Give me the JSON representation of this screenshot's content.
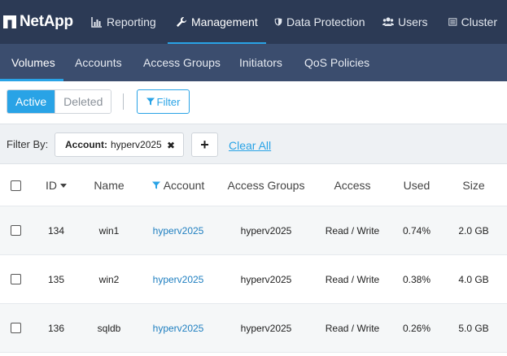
{
  "brand": {
    "name": "NetApp"
  },
  "topnav": {
    "items": [
      {
        "label": "Reporting",
        "icon": "bar-chart-icon"
      },
      {
        "label": "Management",
        "icon": "wrench-icon",
        "active": true
      },
      {
        "label": "Data Protection",
        "icon": "shield-icon"
      },
      {
        "label": "Users",
        "icon": "users-icon"
      },
      {
        "label": "Cluster",
        "icon": "list-icon"
      }
    ]
  },
  "subnav": {
    "items": [
      {
        "label": "Volumes",
        "active": true
      },
      {
        "label": "Accounts"
      },
      {
        "label": "Access Groups"
      },
      {
        "label": "Initiators"
      },
      {
        "label": "QoS Policies"
      }
    ]
  },
  "toolbar": {
    "active_label": "Active",
    "deleted_label": "Deleted",
    "filter_label": "Filter"
  },
  "filterbar": {
    "label": "Filter By:",
    "chip_key": "Account:",
    "chip_value": "hyperv2025",
    "add_label": "+",
    "clear_label": "Clear All"
  },
  "table": {
    "headers": {
      "id": "ID",
      "name": "Name",
      "account": "Account",
      "access_groups": "Access Groups",
      "access": "Access",
      "used": "Used",
      "size": "Size"
    },
    "rows": [
      {
        "id": "134",
        "name": "win1",
        "account": "hyperv2025",
        "access_groups": "hyperv2025",
        "access": "Read / Write",
        "used": "0.74%",
        "size": "2.0 GB"
      },
      {
        "id": "135",
        "name": "win2",
        "account": "hyperv2025",
        "access_groups": "hyperv2025",
        "access": "Read / Write",
        "used": "0.38%",
        "size": "4.0 GB"
      },
      {
        "id": "136",
        "name": "sqldb",
        "account": "hyperv2025",
        "access_groups": "hyperv2025",
        "access": "Read / Write",
        "used": "0.26%",
        "size": "5.0 GB"
      }
    ]
  },
  "colors": {
    "topbar": "#2c3a55",
    "subbar": "#3b4d6e",
    "accent": "#29a3e6",
    "link": "#1f7fc0"
  }
}
